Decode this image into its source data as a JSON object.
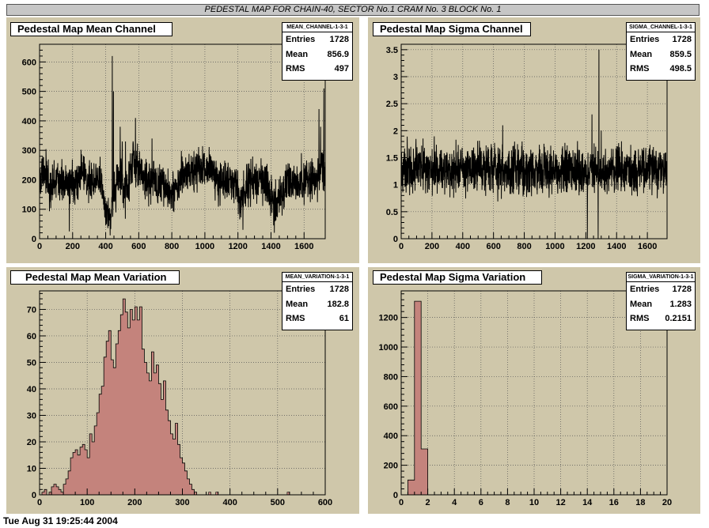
{
  "canvas_title": "PEDESTAL MAP FOR CHAIN-40, SECTOR No.1 CRAM No. 3 BLOCK No. 1",
  "footer_text": "Tue Aug 31 19:25:44 2004",
  "colors": {
    "pad_bg": "#cfc7aa",
    "hist_fill": "#c4837c",
    "line": "#000000"
  },
  "chart_data": [
    {
      "type": "line",
      "title": "Pedestal Map Mean Channel",
      "stats": {
        "name": "MEAN_CHANNEL-1-3-1",
        "entries_label": "Entries",
        "entries": "1728",
        "mean_label": "Mean",
        "mean": "856.9",
        "rms_label": "RMS",
        "rms": "497"
      },
      "xlim": [
        0,
        1728
      ],
      "ylim": [
        0,
        660
      ],
      "x_ticks": [
        0,
        200,
        400,
        600,
        800,
        1000,
        1200,
        1400,
        1600
      ],
      "y_ticks": [
        0,
        100,
        200,
        300,
        400,
        500,
        600
      ],
      "grid": true,
      "nbins": 1728,
      "baseline": [
        [
          0,
          195
        ],
        [
          40,
          240
        ],
        [
          60,
          150
        ],
        [
          100,
          210
        ],
        [
          140,
          185
        ],
        [
          200,
          190
        ],
        [
          260,
          225
        ],
        [
          300,
          200
        ],
        [
          360,
          210
        ],
        [
          390,
          120
        ],
        [
          420,
          70
        ],
        [
          450,
          140
        ],
        [
          480,
          210
        ],
        [
          520,
          150
        ],
        [
          560,
          260
        ],
        [
          600,
          235
        ],
        [
          640,
          200
        ],
        [
          680,
          190
        ],
        [
          720,
          190
        ],
        [
          760,
          175
        ],
        [
          800,
          160
        ],
        [
          840,
          170
        ],
        [
          860,
          210
        ],
        [
          920,
          225
        ],
        [
          1000,
          240
        ],
        [
          1040,
          245
        ],
        [
          1080,
          190
        ],
        [
          1140,
          200
        ],
        [
          1180,
          185
        ],
        [
          1210,
          125
        ],
        [
          1260,
          190
        ],
        [
          1300,
          200
        ],
        [
          1340,
          200
        ],
        [
          1380,
          185
        ],
        [
          1400,
          140
        ],
        [
          1440,
          110
        ],
        [
          1500,
          200
        ],
        [
          1560,
          190
        ],
        [
          1620,
          200
        ],
        [
          1680,
          195
        ],
        [
          1710,
          230
        ],
        [
          1727,
          255
        ]
      ],
      "noise": 35,
      "spikes": [
        [
          440,
          620
        ],
        [
          447,
          500
        ],
        [
          488,
          380
        ],
        [
          500,
          330
        ],
        [
          520,
          330
        ],
        [
          580,
          410
        ],
        [
          680,
          340
        ],
        [
          1690,
          440
        ],
        [
          1700,
          380
        ],
        [
          1720,
          510
        ]
      ],
      "dips": [
        [
          180,
          25
        ],
        [
          1230,
          30
        ],
        [
          1420,
          20
        ]
      ]
    },
    {
      "type": "line",
      "title": "Pedestal Map Sigma Channel",
      "stats": {
        "name": "SIGMA_CHANNEL-1-3-1",
        "entries_label": "Entries",
        "entries": "1728",
        "mean_label": "Mean",
        "mean": "859.5",
        "rms_label": "RMS",
        "rms": "498.5"
      },
      "xlim": [
        0,
        1728
      ],
      "ylim": [
        0,
        3.6
      ],
      "x_ticks": [
        0,
        200,
        400,
        600,
        800,
        1000,
        1200,
        1400,
        1600
      ],
      "y_ticks": [
        0,
        0.5,
        1,
        1.5,
        2,
        2.5,
        3,
        3.5
      ],
      "y_tick_labels": [
        "0",
        "0.5",
        "1",
        "1.5",
        "2",
        "2.5",
        "3",
        "3.5"
      ],
      "grid": true,
      "nbins": 1728,
      "baseline": [
        [
          0,
          1.28
        ],
        [
          1727,
          1.28
        ]
      ],
      "noise": 0.22,
      "spikes": [
        [
          1285,
          3.5
        ],
        [
          1240,
          2.3
        ],
        [
          660,
          2.1
        ],
        [
          1300,
          2.0
        ]
      ],
      "dips": [
        [
          1210,
          0.0
        ],
        [
          1280,
          0.0
        ]
      ]
    },
    {
      "type": "histogram",
      "title": "Pedestal Map Mean Variation",
      "stats": {
        "name": "MEAN_VARIATION-1-3-1",
        "entries_label": "Entries",
        "entries": "1728",
        "mean_label": "Mean",
        "mean": "182.8",
        "rms_label": "RMS",
        "rms": "61"
      },
      "xlim": [
        0,
        600
      ],
      "ylim": [
        0,
        77
      ],
      "x_ticks": [
        0,
        100,
        200,
        300,
        400,
        500,
        600
      ],
      "y_ticks": [
        0,
        10,
        20,
        30,
        40,
        50,
        60,
        70
      ],
      "grid": true,
      "bin_width": 5,
      "bins_x0": 0,
      "values": [
        0,
        1,
        2,
        0,
        1,
        3,
        4,
        3,
        2,
        1,
        4,
        6,
        9,
        14,
        16,
        17,
        15,
        18,
        19,
        17,
        14,
        23,
        20,
        26,
        31,
        38,
        41,
        52,
        58,
        62,
        51,
        48,
        57,
        62,
        68,
        74,
        69,
        63,
        70,
        66,
        71,
        66,
        71,
        55,
        50,
        46,
        43,
        54,
        46,
        49,
        42,
        36,
        43,
        32,
        28,
        23,
        21,
        27,
        19,
        14,
        12,
        9,
        6,
        4,
        2,
        1,
        0,
        0,
        0,
        0,
        0,
        0,
        0,
        0,
        0,
        0,
        0,
        0,
        0,
        0,
        0,
        0,
        0,
        0,
        0,
        0,
        0,
        0,
        0,
        0,
        0,
        0,
        0,
        0,
        0,
        0,
        0,
        0,
        0,
        0,
        0,
        0,
        0,
        0,
        0,
        0,
        0,
        0,
        0,
        0,
        0,
        0,
        0,
        0,
        0,
        0,
        0,
        0,
        0,
        0
      ],
      "isolated": [
        [
          355,
          1
        ],
        [
          370,
          1
        ],
        [
          520,
          1
        ]
      ]
    },
    {
      "type": "histogram",
      "title": "Pedestal Map Sigma Variation",
      "stats": {
        "name": "SIGMA_VARIATION-1-3-1",
        "entries_label": "Entries",
        "entries": "1728",
        "mean_label": "Mean",
        "mean": "1.283",
        "rms_label": "RMS",
        "rms": "0.2151"
      },
      "xlim": [
        0,
        20
      ],
      "ylim": [
        0,
        1380
      ],
      "x_ticks": [
        0,
        2,
        4,
        6,
        8,
        10,
        12,
        14,
        16,
        18,
        20
      ],
      "y_ticks": [
        0,
        200,
        400,
        600,
        800,
        1000,
        1200
      ],
      "grid": true,
      "bin_width": 0.5,
      "bins_x0": 0.5,
      "values": [
        100,
        1310,
        310
      ],
      "isolated": []
    }
  ]
}
